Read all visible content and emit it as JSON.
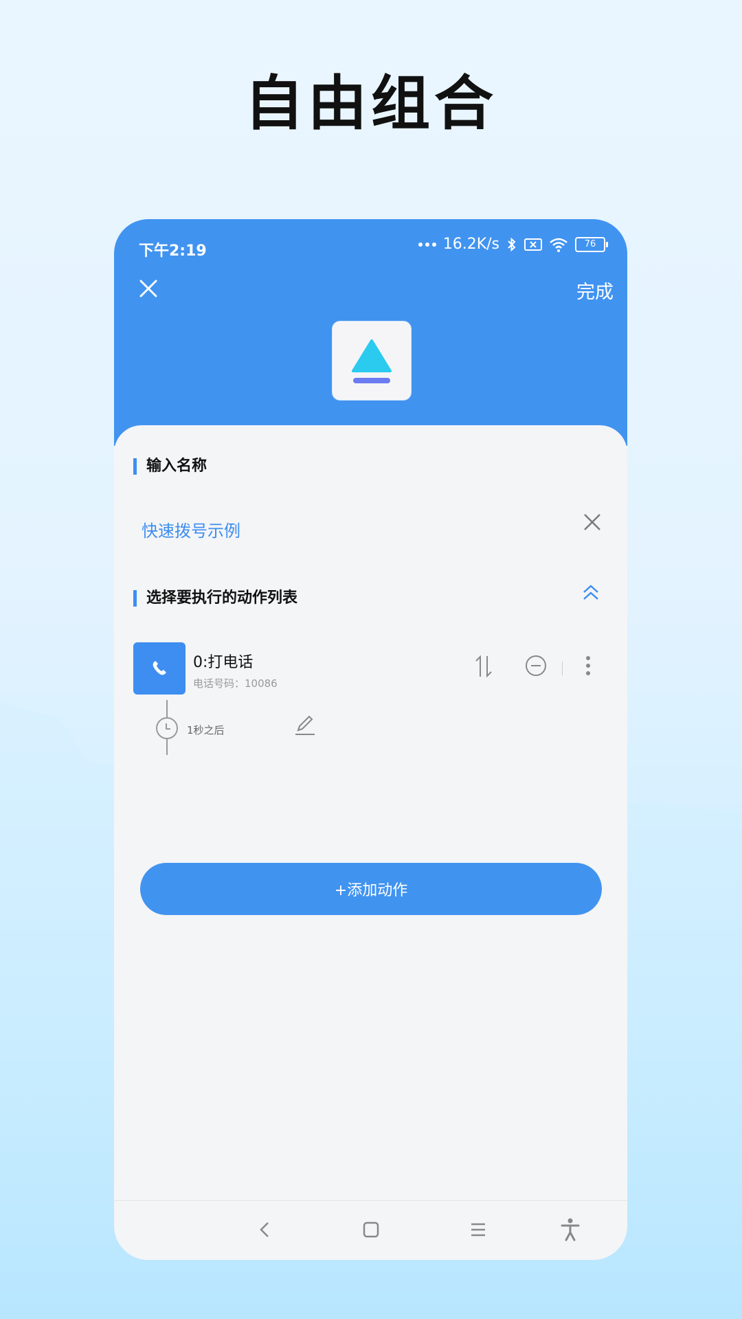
{
  "headline": "自由组合",
  "status_bar": {
    "time": "下午2:19",
    "speed": "16.2K/s",
    "battery": "76"
  },
  "header": {
    "done_label": "完成"
  },
  "form": {
    "name_section_title": "输入名称",
    "name_value": "快速拨号示例",
    "actions_section_title": "选择要执行的动作列表"
  },
  "actions": [
    {
      "title": "0:打电话",
      "subtitle": "电话号码：10086",
      "delay": "1秒之后"
    }
  ],
  "add_action_label": "+添加动作",
  "colors": {
    "primary": "#4193f0",
    "sheet": "#f4f5f7"
  }
}
